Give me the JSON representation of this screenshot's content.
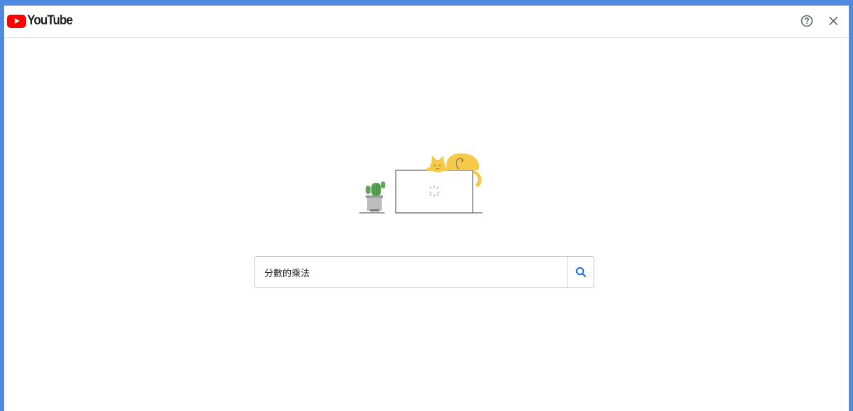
{
  "header": {
    "logo_text": "YouTube",
    "help_icon": "help-circle-icon",
    "close_icon": "close-icon"
  },
  "illustration": {
    "description_icon": "cat-on-laptop-illustration"
  },
  "search": {
    "value": "分數的乘法",
    "button_icon": "search-icon"
  },
  "colors": {
    "frame_border": "#4f89e0",
    "brand_red": "#ff0000",
    "search_icon": "#1a73e8",
    "cat": "#f7c948",
    "cactus": "#5fa55a",
    "pot": "#bdbdbd"
  }
}
